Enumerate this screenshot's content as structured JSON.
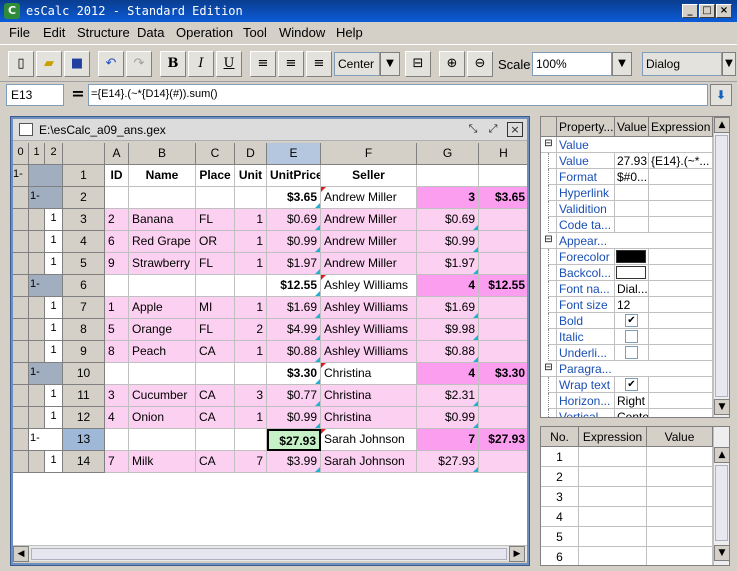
{
  "window": {
    "app_icon": "C",
    "title": "esCalc 2012 - Standard Edition",
    "min": "_",
    "max": "□",
    "close": "×"
  },
  "menu": [
    "File",
    "Edit",
    "Structure",
    "Data",
    "Operation",
    "Tool",
    "Window",
    "Help"
  ],
  "toolbar": {
    "bold": "B",
    "italic": "I",
    "underline": "U",
    "align_value": "Center",
    "scale_label": "Scale",
    "scale_value": "100%",
    "font_value": "Dialog"
  },
  "formula_bar": {
    "cell_ref": "E13",
    "equals": "=",
    "formula": "={E14}.(~*{D14}(#)).sum()"
  },
  "document": {
    "title": "E:\\esCalc_a09_ans.gex",
    "levels": [
      "0",
      "1",
      "2"
    ],
    "columns": [
      "A",
      "B",
      "C",
      "D",
      "E",
      "F",
      "G",
      "H"
    ],
    "rows": [
      {
        "num": "1",
        "lvl1": "1-",
        "lvl2": "",
        "A": "ID",
        "B": "Name",
        "C": "Place",
        "D": "Unit",
        "E": "UnitPrice",
        "F": "Seller",
        "G": "",
        "H": "",
        "kind": "header"
      },
      {
        "num": "2",
        "lvl1": "",
        "lvl2": "1-",
        "A": "",
        "B": "",
        "C": "",
        "D": "",
        "E": "$3.65",
        "F": "Andrew Miller",
        "G": "3",
        "H": "$3.65",
        "kind": "group"
      },
      {
        "num": "3",
        "lvl1": "",
        "lvl2": "",
        "lvl3": "1",
        "A": "2",
        "B": "Banana",
        "C": "FL",
        "D": "1",
        "E": "$0.69",
        "F": "Andrew Miller",
        "G": "$0.69",
        "H": "",
        "kind": "detail"
      },
      {
        "num": "4",
        "lvl1": "",
        "lvl2": "",
        "lvl3": "1",
        "A": "6",
        "B": "Red Grape",
        "C": "OR",
        "D": "1",
        "E": "$0.99",
        "F": "Andrew Miller",
        "G": "$0.99",
        "H": "",
        "kind": "detail"
      },
      {
        "num": "5",
        "lvl1": "",
        "lvl2": "",
        "lvl3": "1",
        "A": "9",
        "B": "Strawberry",
        "C": "FL",
        "D": "1",
        "E": "$1.97",
        "F": "Andrew Miller",
        "G": "$1.97",
        "H": "",
        "kind": "detail"
      },
      {
        "num": "6",
        "lvl1": "",
        "lvl2": "1-",
        "A": "",
        "B": "",
        "C": "",
        "D": "",
        "E": "$12.55",
        "F": "Ashley Williams",
        "G": "4",
        "H": "$12.55",
        "kind": "group"
      },
      {
        "num": "7",
        "lvl1": "",
        "lvl2": "",
        "lvl3": "1",
        "A": "1",
        "B": "Apple",
        "C": "MI",
        "D": "1",
        "E": "$1.69",
        "F": "Ashley Williams",
        "G": "$1.69",
        "H": "",
        "kind": "detail"
      },
      {
        "num": "8",
        "lvl1": "",
        "lvl2": "",
        "lvl3": "1",
        "A": "5",
        "B": "Orange",
        "C": "FL",
        "D": "2",
        "E": "$4.99",
        "F": "Ashley Williams",
        "G": "$9.98",
        "H": "",
        "kind": "detail"
      },
      {
        "num": "9",
        "lvl1": "",
        "lvl2": "",
        "lvl3": "1",
        "A": "8",
        "B": "Peach",
        "C": "CA",
        "D": "1",
        "E": "$0.88",
        "F": "Ashley Williams",
        "G": "$0.88",
        "H": "",
        "kind": "detail"
      },
      {
        "num": "10",
        "lvl1": "",
        "lvl2": "1-",
        "A": "",
        "B": "",
        "C": "",
        "D": "",
        "E": "$3.30",
        "F": "Christina",
        "G": "4",
        "H": "$3.30",
        "kind": "group"
      },
      {
        "num": "11",
        "lvl1": "",
        "lvl2": "",
        "lvl3": "1",
        "A": "3",
        "B": "Cucumber",
        "C": "CA",
        "D": "3",
        "E": "$0.77",
        "F": "Christina",
        "G": "$2.31",
        "H": "",
        "kind": "detail"
      },
      {
        "num": "12",
        "lvl1": "",
        "lvl2": "",
        "lvl3": "1",
        "A": "4",
        "B": "Onion",
        "C": "CA",
        "D": "1",
        "E": "$0.99",
        "F": "Christina",
        "G": "$0.99",
        "H": "",
        "kind": "detail"
      },
      {
        "num": "13",
        "lvl1": "",
        "lvl2": "1-",
        "A": "",
        "B": "",
        "C": "",
        "D": "",
        "E": "$27.93",
        "F": "Sarah Johnson",
        "G": "7",
        "H": "$27.93",
        "kind": "group",
        "selected": true
      },
      {
        "num": "14",
        "lvl1": "",
        "lvl2": "",
        "lvl3": "1",
        "A": "7",
        "B": "Milk",
        "C": "CA",
        "D": "7",
        "E": "$3.99",
        "F": "Sarah Johnson",
        "G": "$27.93",
        "H": "",
        "kind": "detail"
      }
    ]
  },
  "properties": {
    "headers": [
      "Property...",
      "Value",
      "Expression"
    ],
    "rows": [
      {
        "type": "group",
        "name": "Value",
        "value": "",
        "expr": ""
      },
      {
        "type": "prop",
        "name": "Value",
        "value": "27.93",
        "expr": "{E14}.(~*..."
      },
      {
        "type": "prop",
        "name": "Format",
        "value": "$#0...",
        "expr": ""
      },
      {
        "type": "prop",
        "name": "Hyperlink",
        "value": "",
        "expr": ""
      },
      {
        "type": "prop",
        "name": "Validition",
        "value": "",
        "expr": ""
      },
      {
        "type": "prop",
        "name": "Code ta...",
        "value": "",
        "expr": ""
      },
      {
        "type": "group",
        "name": "Appear...",
        "value": "",
        "expr": ""
      },
      {
        "type": "color",
        "name": "Forecolor",
        "value": "#000000",
        "expr": ""
      },
      {
        "type": "color",
        "name": "Backcol...",
        "value": "#ffffff",
        "expr": ""
      },
      {
        "type": "prop",
        "name": "Font na...",
        "value": "Dial...",
        "expr": ""
      },
      {
        "type": "prop",
        "name": "Font size",
        "value": "12",
        "expr": ""
      },
      {
        "type": "check",
        "name": "Bold",
        "value": "✔",
        "expr": ""
      },
      {
        "type": "check",
        "name": "Italic",
        "value": "",
        "expr": ""
      },
      {
        "type": "check",
        "name": "Underli...",
        "value": "",
        "expr": ""
      },
      {
        "type": "group",
        "name": "Paragra...",
        "value": "",
        "expr": ""
      },
      {
        "type": "check",
        "name": "Wrap text",
        "value": "✔",
        "expr": ""
      },
      {
        "type": "prop",
        "name": "Horizon...",
        "value": "Right",
        "expr": ""
      },
      {
        "type": "prop",
        "name": "Vertical",
        "value": "Cente",
        "expr": ""
      }
    ]
  },
  "expressions": {
    "headers": [
      "No.",
      "Expression",
      "Value"
    ],
    "rows": [
      "1",
      "2",
      "3",
      "4",
      "5",
      "6"
    ]
  }
}
